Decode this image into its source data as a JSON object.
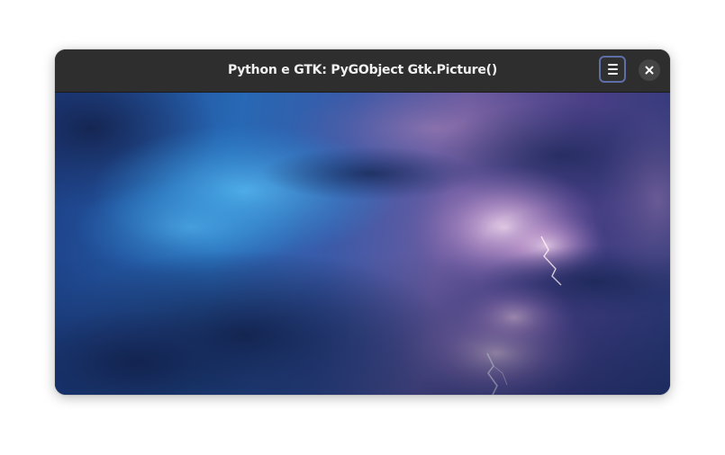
{
  "window": {
    "title": "Python e GTK: PyGObject Gtk.Picture()"
  },
  "header": {
    "menu_icon": "hamburger-menu-icon",
    "close_icon": "close-icon"
  },
  "picture": {
    "subject": "stormy-sky-with-lightning",
    "colors": {
      "accent": "#5e6fa8",
      "sky_blue": "#2f8fd6",
      "cloud_purple": "#7a5fa8",
      "lightning_glow": "#e2c6e6"
    }
  }
}
